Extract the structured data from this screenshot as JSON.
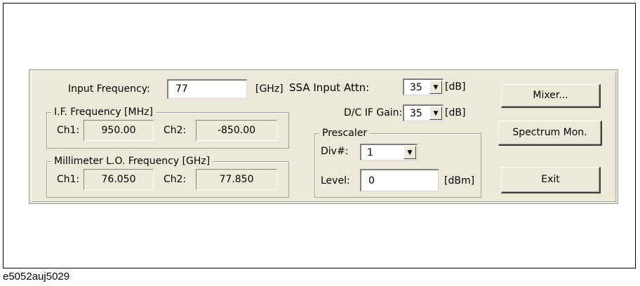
{
  "input_frequency": {
    "label": "Input Frequency:",
    "value": "77",
    "unit": "[GHz]"
  },
  "ssa_input_attn": {
    "label": "SSA Input Attn:",
    "value": "35",
    "unit": "[dB]"
  },
  "dc_if_gain": {
    "label": "D/C IF Gain:",
    "value": "35",
    "unit": "[dB]"
  },
  "if_frequency": {
    "title": "I.F. Frequency [MHz]",
    "ch1_label": "Ch1:",
    "ch1_value": "950.00",
    "ch2_label": "Ch2:",
    "ch2_value": "-850.00"
  },
  "mm_lo_frequency": {
    "title": "Millimeter L.O. Frequency [GHz]",
    "ch1_label": "Ch1:",
    "ch1_value": "76.050",
    "ch2_label": "Ch2:",
    "ch2_value": "77.850"
  },
  "prescaler": {
    "title": "Prescaler",
    "div_label": "Div#:",
    "div_value": "1",
    "level_label": "Level:",
    "level_value": "0",
    "level_unit": "[dBm]"
  },
  "buttons": {
    "mixer": "Mixer...",
    "spectrum": "Spectrum Mon.",
    "exit": "Exit"
  },
  "caption": "e5052auj5029"
}
